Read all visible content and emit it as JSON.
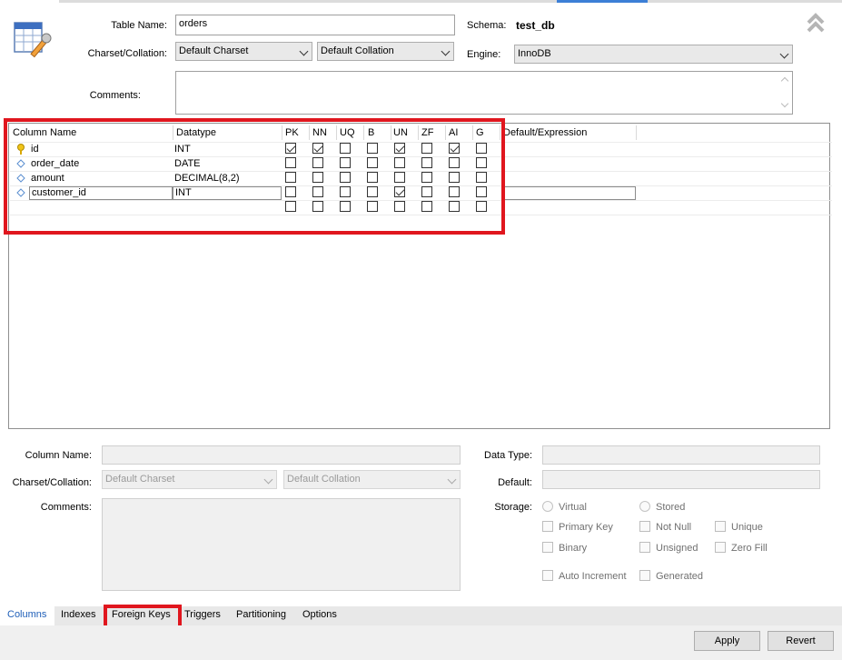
{
  "header": {
    "table_name_label": "Table Name:",
    "table_name_value": "orders",
    "schema_label": "Schema:",
    "schema_value": "test_db",
    "charset_label": "Charset/Collation:",
    "charset_value": "Default Charset",
    "collation_value": "Default Collation",
    "engine_label": "Engine:",
    "engine_value": "InnoDB",
    "comments_label": "Comments:"
  },
  "grid": {
    "headers": [
      "Column Name",
      "Datatype",
      "PK",
      "NN",
      "UQ",
      "B",
      "UN",
      "ZF",
      "AI",
      "G",
      "Default/Expression"
    ],
    "rows": [
      {
        "icon": "primary-key-icon",
        "name": "id",
        "type": "INT",
        "flags": [
          true,
          true,
          false,
          false,
          true,
          false,
          true,
          false
        ]
      },
      {
        "icon": "column-diamond-icon",
        "name": "order_date",
        "type": "DATE",
        "flags": [
          false,
          false,
          false,
          false,
          false,
          false,
          false,
          false
        ]
      },
      {
        "icon": "column-diamond-icon",
        "name": "amount",
        "type": "DECIMAL(8,2)",
        "flags": [
          false,
          false,
          false,
          false,
          false,
          false,
          false,
          false
        ]
      },
      {
        "icon": "column-diamond-icon",
        "name": "customer_id",
        "type": "INT",
        "flags": [
          false,
          false,
          false,
          false,
          true,
          false,
          false,
          false
        ]
      },
      {
        "icon": "",
        "name": "",
        "type": "",
        "flags": [
          false,
          false,
          false,
          false,
          false,
          false,
          false,
          false
        ]
      }
    ]
  },
  "details": {
    "column_name_label": "Column Name:",
    "charset_label": "Charset/Collation:",
    "charset_value": "Default Charset",
    "collation_value": "Default Collation",
    "comments_label": "Comments:",
    "data_type_label": "Data Type:",
    "default_label": "Default:",
    "storage_label": "Storage:",
    "virtual_label": "Virtual",
    "stored_label": "Stored",
    "primary_key_label": "Primary Key",
    "not_null_label": "Not Null",
    "unique_label": "Unique",
    "binary_label": "Binary",
    "unsigned_label": "Unsigned",
    "zero_fill_label": "Zero Fill",
    "auto_increment_label": "Auto Increment",
    "generated_label": "Generated"
  },
  "tabs": [
    "Columns",
    "Indexes",
    "Foreign Keys",
    "Triggers",
    "Partitioning",
    "Options"
  ],
  "active_tab": "Columns",
  "buttons": {
    "apply": "Apply",
    "revert": "Revert"
  },
  "colors": {
    "highlight": "#e0161e",
    "active_tab": "#1f5fb8"
  }
}
